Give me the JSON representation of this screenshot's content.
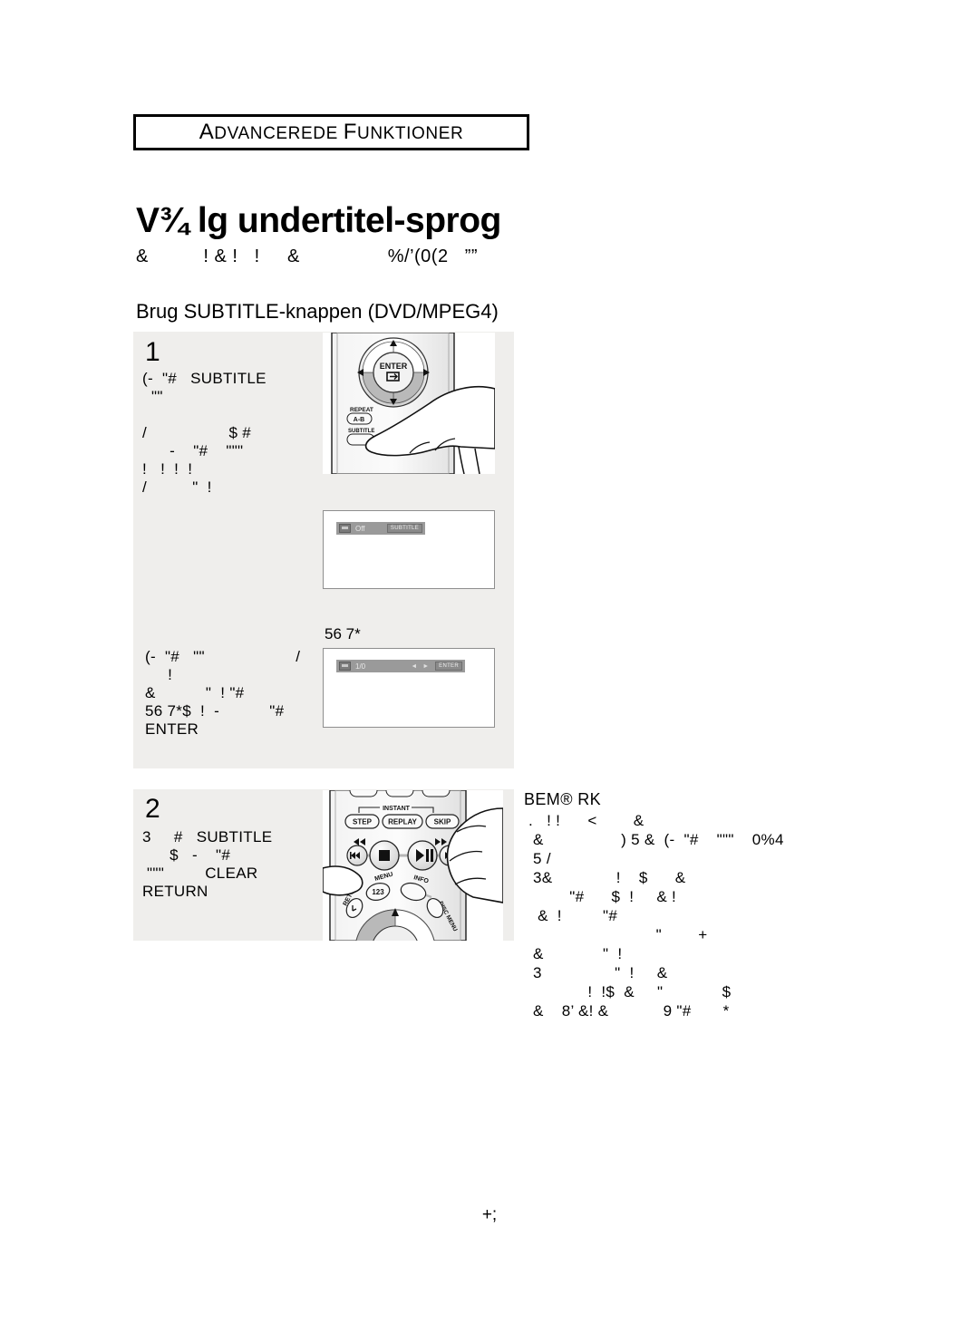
{
  "header": {
    "cap1": "A",
    "rest1": "DVANCEREDE",
    "cap2": "F",
    "rest2": "UNKTIONER",
    "full": "ADVANCEREDE FUNKTIONER"
  },
  "title": {
    "main": "V¾ lg undertitel-sprog",
    "subtitle": "&          ! & !   !     &                %/’(0(2   ””"
  },
  "section": {
    "heading": "Brug SUBTITLE-knappen (DVD/MPEG4)"
  },
  "steps": [
    {
      "number": "1",
      "text": "(-  \"#   SUBTITLE\n  \"\"\n\n/                  $ #\n      -    \"#    \"\"\"\n!   !  !  !\n/          \"  !",
      "text_b": "(-  \"#   \"\"                    /\n     !\n&           \"  ! \"#\n56 7*$  !  -           \"#\nENTER"
    },
    {
      "number": "2",
      "text": "3     #   SUBTITLE\n      $   -    \"#\n \"\"\"         CLEAR\nRETURN"
    }
  ],
  "osd": {
    "label_above_second": "56 7*",
    "screen1": {
      "value": "Off",
      "tag": "SUBTITLE"
    },
    "screen2": {
      "value": "1/0",
      "arrows": "◄ ►",
      "tag": "ENTER"
    }
  },
  "remote1": {
    "enter_label": "ENTER",
    "repeat_label": "REPEAT",
    "repeat_sub": "A-B",
    "subtitle_label": "SUBTITLE"
  },
  "remote2": {
    "instant_label": "INSTANT",
    "step_label": "STEP",
    "replay_label": "REPLAY",
    "skip_label": "SKIP",
    "menu_label": "MENU",
    "info_label": "INFO",
    "return_label": "RETURN",
    "disc_menu_label": "DISC MENU"
  },
  "note": {
    "title": "BEM® RK",
    "body": " .   ! !      <        &\n  &                 ) 5 &  (-  \"#    \"\"\"    0%4\n  5 /\n  3&              !    $      &\n          \"#      $  !     & !\n   &  !         \"#\n                             \"        +\n  &             \"  !\n  3                \"  !     &\n              !  !$  &     \"             $\n  &    8’ &! &            9 \"#       *"
  },
  "footer": {
    "page_number": "+;"
  }
}
